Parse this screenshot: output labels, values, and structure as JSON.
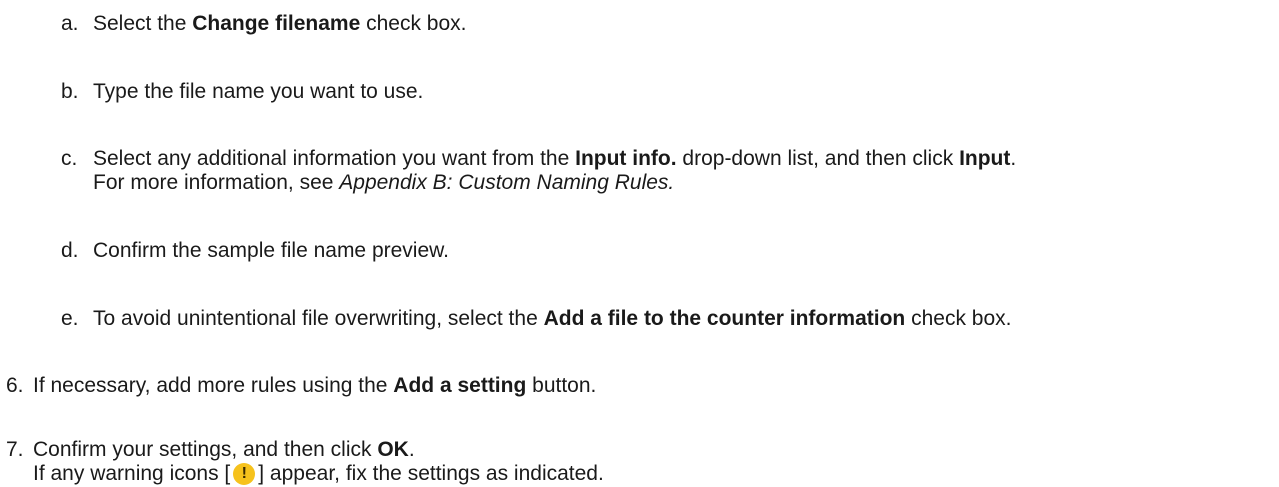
{
  "steps": [
    {
      "marker": "a.",
      "parts": [
        {
          "text": "Select the ",
          "bold": false
        },
        {
          "text": "Change filename",
          "bold": true
        },
        {
          "text": " check box.",
          "bold": false
        }
      ]
    },
    {
      "marker": "b.",
      "parts": [
        {
          "text": "Type the file name you want to use.",
          "bold": false
        }
      ]
    },
    {
      "marker": "c.",
      "parts": [
        {
          "text": "Select any additional information you want from the ",
          "bold": false
        },
        {
          "text": "Input info.",
          "bold": true
        },
        {
          "text": " drop-down list, and then click ",
          "bold": false
        },
        {
          "text": "Input",
          "bold": true
        },
        {
          "text": ".",
          "bold": false
        }
      ],
      "continuation": {
        "prefix": "For more information, see ",
        "link": "Appendix B: Custom Naming Rules."
      }
    },
    {
      "marker": "d.",
      "parts": [
        {
          "text": "Confirm the sample file name preview.",
          "bold": false
        }
      ]
    },
    {
      "marker": "e.",
      "parts": [
        {
          "text": "To avoid unintentional file overwriting, select the ",
          "bold": false
        },
        {
          "text": "Add a file to the counter information",
          "bold": true
        },
        {
          "text": " check box.",
          "bold": false
        }
      ]
    },
    {
      "marker": "6.",
      "parts": [
        {
          "text": "If necessary, add more rules using the ",
          "bold": false
        },
        {
          "text": "Add a setting",
          "bold": true
        },
        {
          "text": " button.",
          "bold": false
        }
      ]
    },
    {
      "marker": "7.",
      "parts": [
        {
          "text": "Confirm your settings, and then click ",
          "bold": false
        },
        {
          "text": "OK",
          "bold": true
        },
        {
          "text": ".",
          "bold": false
        }
      ],
      "warning_line": {
        "before": "If any warning icons [",
        "icon": "warning-icon",
        "icon_glyph": "!",
        "icon_color": "#f6c21c",
        "after": "] appear, fix the settings as indicated."
      }
    }
  ]
}
